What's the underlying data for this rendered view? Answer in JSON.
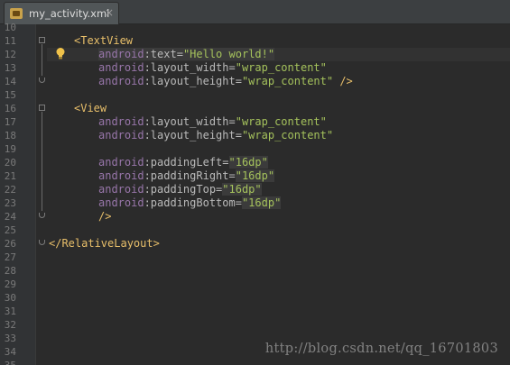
{
  "tab": {
    "file_name": "my_activity.xml",
    "icon": "xml-file-icon",
    "close": "×"
  },
  "gutter": {
    "line_numbers": [
      "10",
      "11",
      "12",
      "13",
      "14",
      "15",
      "16",
      "17",
      "18",
      "19",
      "20",
      "21",
      "22",
      "23",
      "24",
      "25",
      "26",
      "27",
      "28",
      "29",
      "30",
      "31",
      "32",
      "33",
      "34",
      "35"
    ]
  },
  "code": {
    "l11": {
      "open": "<",
      "tag": "TextView"
    },
    "l12": {
      "ns": "android",
      "attr": ":text=",
      "val1": "\"Hello wor",
      "val2": "ld!\""
    },
    "l13": {
      "ns": "android",
      "attr": ":layout_width=",
      "val": "\"wrap_content\""
    },
    "l14": {
      "ns": "android",
      "attr": ":layout_height=",
      "val": "\"wrap_content\"",
      "close": " />"
    },
    "l16": {
      "open": "<",
      "tag": "View"
    },
    "l17": {
      "ns": "android",
      "attr": ":layout_width=",
      "val": "\"wrap_content\""
    },
    "l18": {
      "ns": "android",
      "attr": ":layout_height=",
      "val": "\"wrap_content\""
    },
    "l20": {
      "ns": "android",
      "attr": ":paddingLeft=",
      "val": "\"16dp\""
    },
    "l21": {
      "ns": "android",
      "attr": ":paddingRight=",
      "val": "\"16dp\""
    },
    "l22": {
      "ns": "android",
      "attr": ":paddingTop=",
      "val": "\"16dp\""
    },
    "l23": {
      "ns": "android",
      "attr": ":paddingBottom=",
      "val": "\"16dp\""
    },
    "l24": {
      "close": "/>"
    },
    "l26": {
      "open": "</",
      "tag": "RelativeLayout",
      "end": ">"
    }
  },
  "watermark": "http://blog.csdn.net/qq_16701803",
  "colors": {
    "background": "#2b2b2b",
    "gutter": "#313335",
    "tag": "#e8bf6a",
    "namespace": "#9876aa",
    "attribute": "#bababa",
    "string": "#a5c25c"
  }
}
